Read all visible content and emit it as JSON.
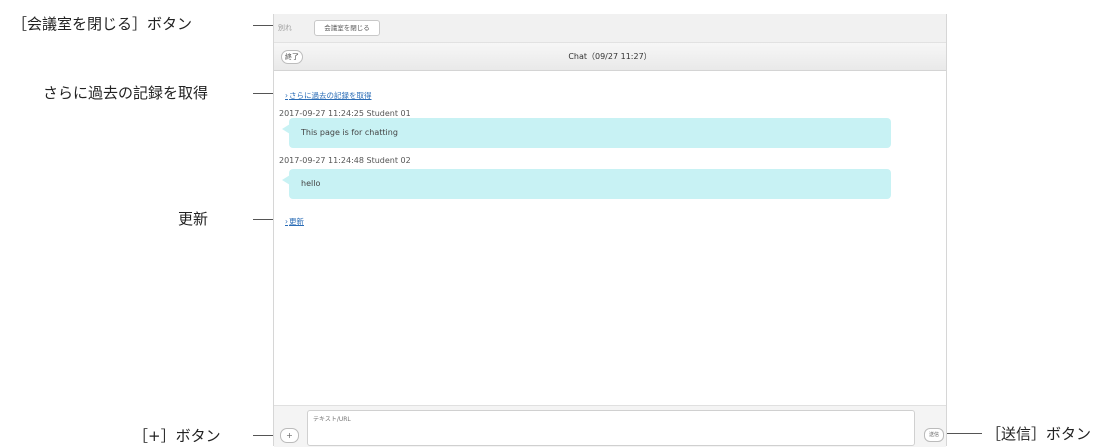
{
  "annotations": {
    "close_room_button": "［会議室を閉じる］ボタン",
    "fetch_more_history": "さらに過去の記録を取得",
    "refresh": "更新",
    "plus_button": "［+］ボタン",
    "send_button": "［送信］ボタン"
  },
  "toolbar": {
    "label": "別れ",
    "close_room_label": "会議室を閉じる"
  },
  "chat_header": {
    "end_label": "終了",
    "title": "Chat（09/27 11:27）"
  },
  "messages": {
    "more_history_link": "さらに過去の記録を取得",
    "items": [
      {
        "meta": "2017-09-27 11:24:25 Student 01",
        "text": "This page is for chatting"
      },
      {
        "meta": "2017-09-27 11:24:48 Student 02",
        "text": "hello"
      }
    ],
    "refresh_link": "更新"
  },
  "input": {
    "plus_label": "+",
    "placeholder": "テキスト/URL",
    "send_label": "送信"
  }
}
